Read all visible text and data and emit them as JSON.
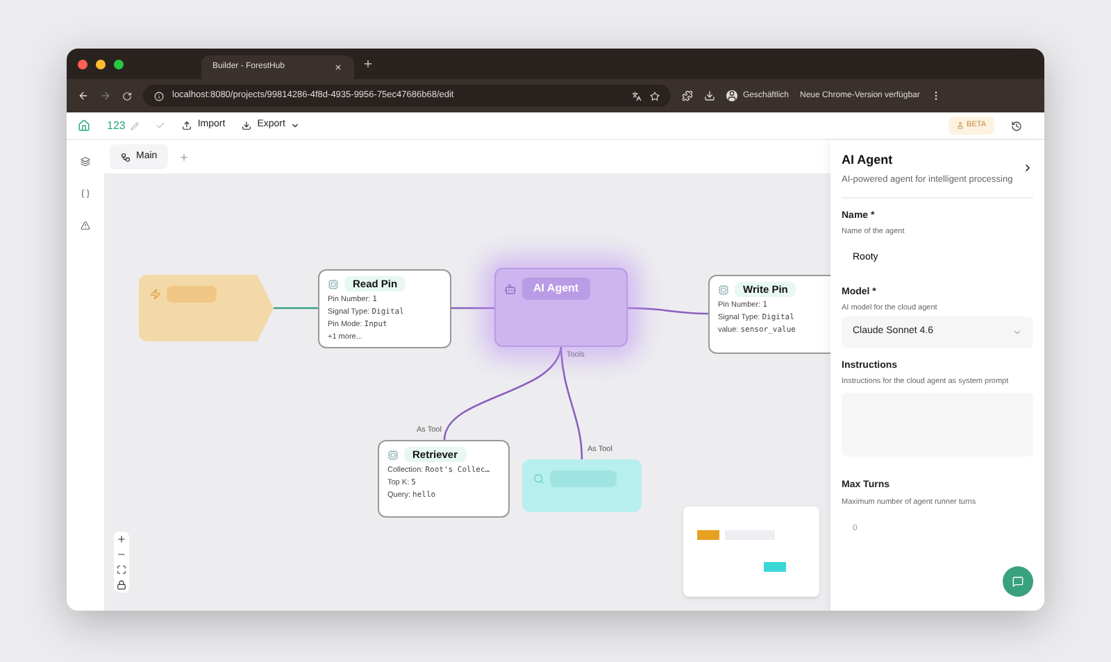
{
  "browser": {
    "tab_title": "Builder - ForestHub",
    "url": "localhost:8080/projects/99814286-4f8d-4935-9956-75ec47686b68/edit",
    "profile": "Geschäftlich",
    "update_notice": "Neue Chrome-Version verfügbar"
  },
  "toolbar": {
    "project": "123",
    "import": "Import",
    "export": "Export",
    "badge": "BETA"
  },
  "tabs": [
    {
      "label": "Main",
      "selected": true
    }
  ],
  "nodes": [
    {
      "kind": "trigger"
    },
    {
      "kind": "card",
      "title": "Read Pin",
      "lines": [
        {
          "label": "Pin Number:",
          "value": "1"
        },
        {
          "label": "Signal Type:",
          "value": "Digital"
        },
        {
          "label": "Pin Mode:",
          "value": "Input"
        },
        {
          "label": "+1 more..."
        }
      ]
    },
    {
      "kind": "agent",
      "title": "AI Agent"
    },
    {
      "kind": "card",
      "title": "Write Pin",
      "lines": [
        {
          "label": "Pin Number:",
          "value": "1"
        },
        {
          "label": "Signal Type:",
          "value": "Digital"
        },
        {
          "label": "value:",
          "value": "sensor_value"
        }
      ]
    },
    {
      "kind": "card",
      "title": "Retriever",
      "lines": [
        {
          "label": "Collection:",
          "value": "Root's Collec…"
        },
        {
          "label": "Top K:",
          "value": "5"
        },
        {
          "label": "Query:",
          "value": "hello"
        }
      ]
    },
    {
      "kind": "tool"
    }
  ],
  "edge_labels": [
    {
      "text": "Tools"
    },
    {
      "text": "As Tool"
    },
    {
      "text": "As Tool"
    }
  ],
  "panel": {
    "title": "AI Agent",
    "subtitle": "AI-powered agent for intelligent processing",
    "fields": [
      {
        "kind": "text",
        "label": "Name *",
        "hint": "Name of the agent",
        "value": "Rooty"
      },
      {
        "kind": "select",
        "label": "Model *",
        "hint": "AI model for the cloud agent",
        "value": "Claude Sonnet 4.6"
      },
      {
        "kind": "textarea",
        "label": "Instructions",
        "hint": "Instructions for the cloud agent as system prompt"
      },
      {
        "kind": "number",
        "label": "Max Turns",
        "hint": "Maximum number of agent runner turns",
        "placeholder": "0"
      }
    ]
  }
}
